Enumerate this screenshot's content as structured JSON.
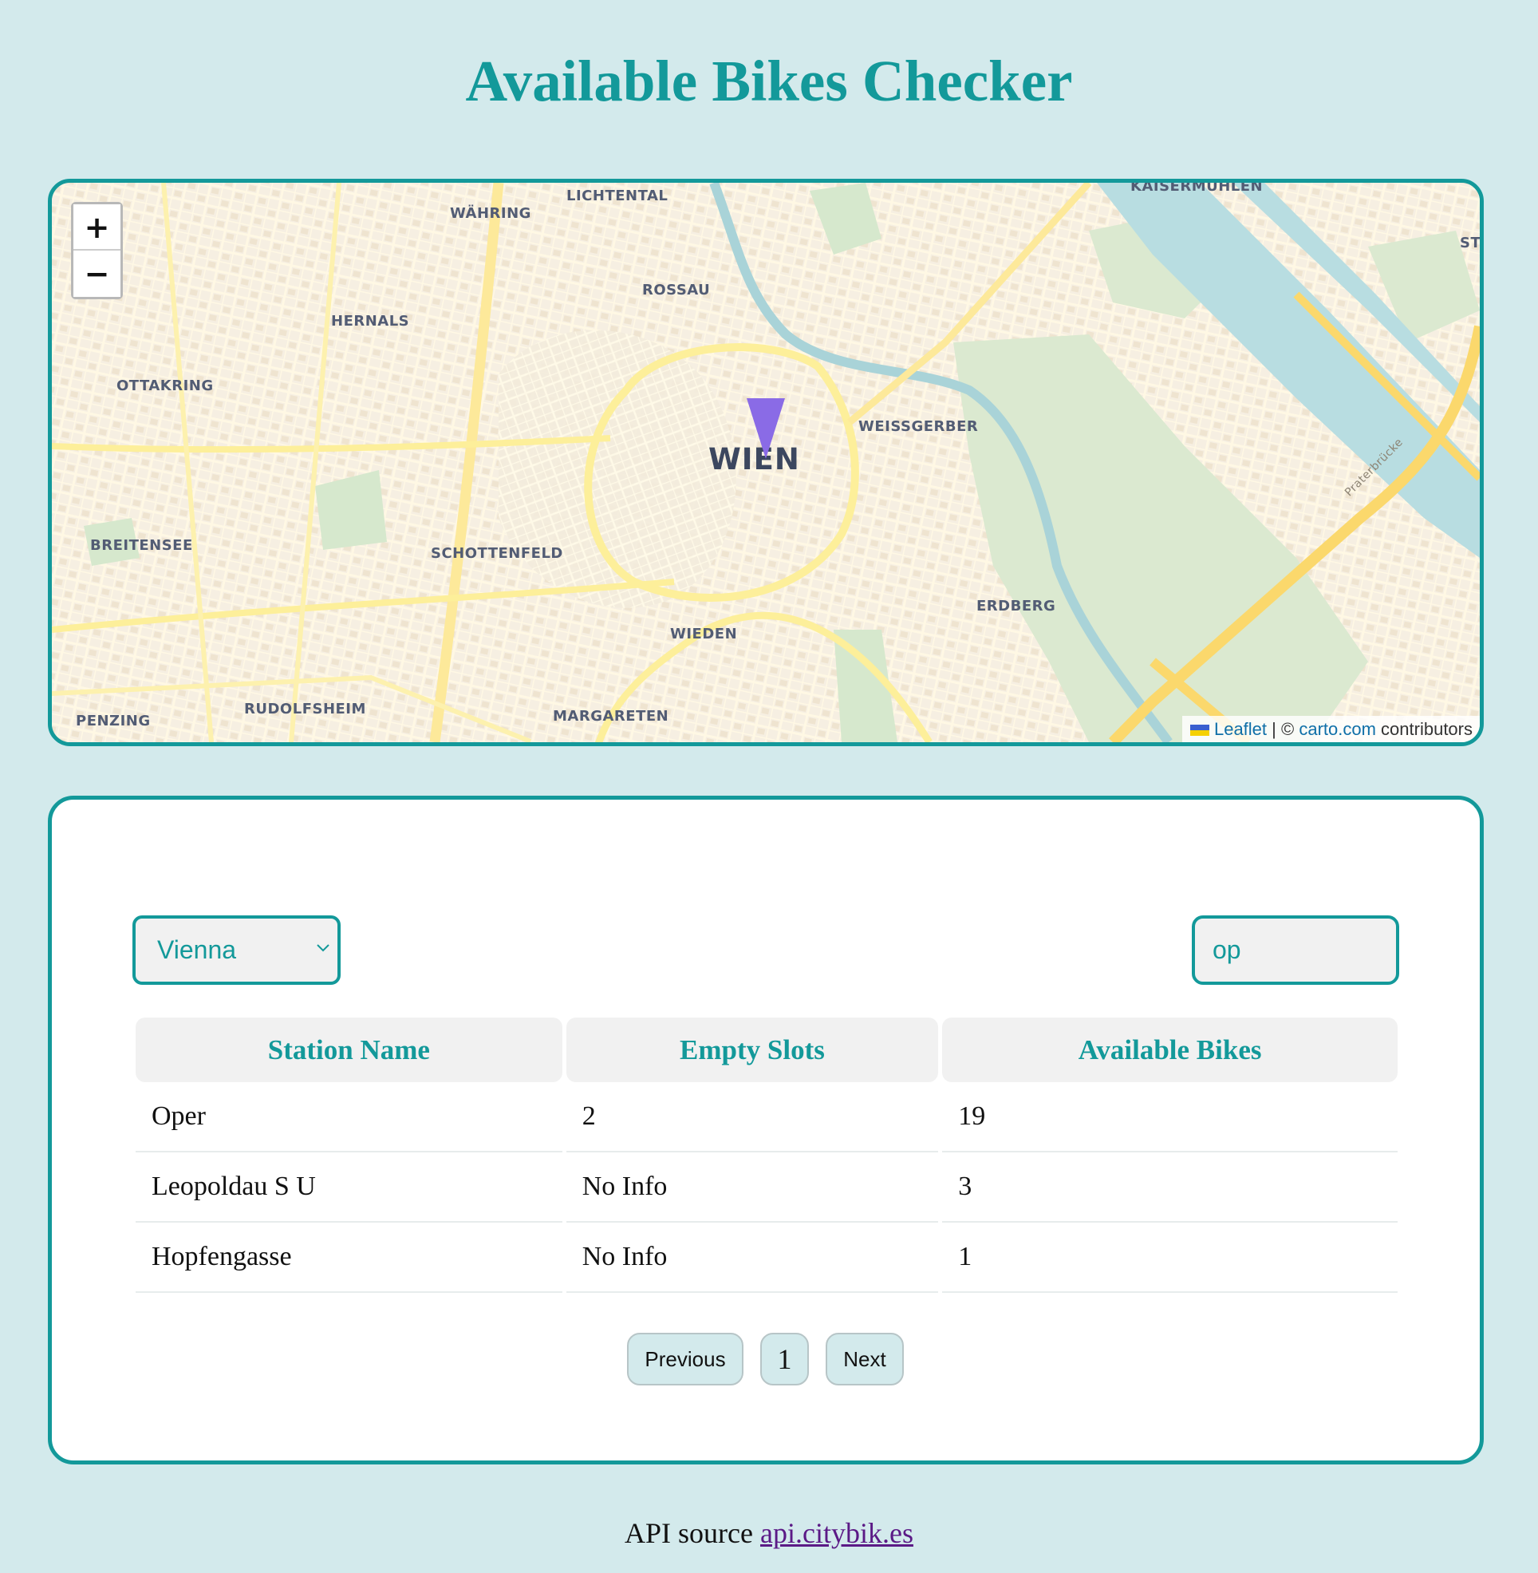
{
  "page": {
    "title": "Available Bikes Checker"
  },
  "map": {
    "zoom_in_label": "+",
    "zoom_out_label": "−",
    "labels": {
      "wien": "WIEN",
      "lichtental": "LICHTENTAL",
      "waehring": "WÄHRING",
      "kaisermuehlen": "KAISERMÜHLEN",
      "rossau": "ROSSAU",
      "hernals": "HERNALS",
      "ottakring": "OTTAKRING",
      "weissgerber": "WEISSGERBER",
      "breitensee": "BREITENSEE",
      "schottenfeld": "SCHOTTENFELD",
      "erdberg": "ERDBERG",
      "wieden": "WIEDEN",
      "rudolfsheim": "RUDOLFSHEIM",
      "penzing": "PENZING",
      "margareten": "MARGARETEN",
      "st": "ST",
      "praterbruecke": "Praterbrücke"
    },
    "attribution": {
      "leaflet": "Leaflet",
      "separator": "| ©",
      "carto": "carto.com",
      "contributors": "contributors"
    },
    "marker_color": "#8a6be6"
  },
  "controls": {
    "city_value": "Vienna",
    "search_value": "op"
  },
  "table": {
    "headers": [
      "Station Name",
      "Empty Slots",
      "Available Bikes"
    ],
    "rows": [
      {
        "name": "Oper",
        "empty_slots": "2",
        "available_bikes": "19"
      },
      {
        "name": "Leopoldau S U",
        "empty_slots": "No Info",
        "available_bikes": "3"
      },
      {
        "name": "Hopfengasse",
        "empty_slots": "No Info",
        "available_bikes": "1"
      }
    ]
  },
  "pagination": {
    "previous": "Previous",
    "page": "1",
    "next": "Next"
  },
  "footer": {
    "text": "API source",
    "link": "api.citybik.es"
  },
  "colors": {
    "accent": "#13999a",
    "background": "#d3eaec"
  }
}
